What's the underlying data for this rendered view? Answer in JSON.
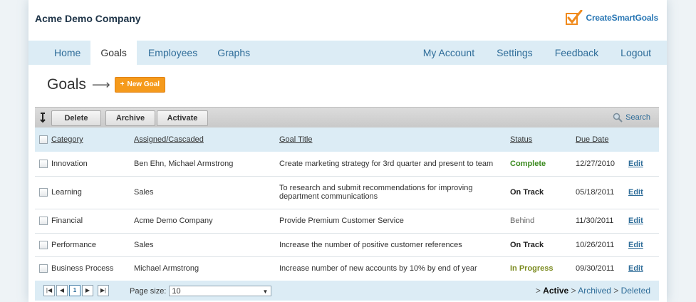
{
  "header": {
    "company": "Acme Demo Company",
    "logo_text": "CreateSmartGoals"
  },
  "nav": {
    "left": [
      "Home",
      "Goals",
      "Employees",
      "Graphs"
    ],
    "right": [
      "My Account",
      "Settings",
      "Feedback",
      "Logout"
    ],
    "active": "Goals"
  },
  "page": {
    "title": "Goals",
    "arrow": "⟶",
    "new_goal_label": "New Goal"
  },
  "toolbar": {
    "delete_label": "Delete",
    "archive_label": "Archive",
    "activate_label": "Activate",
    "search_label": "Search"
  },
  "table": {
    "headers": {
      "category": "Category",
      "assigned": "Assigned/Cascaded",
      "goal_title": "Goal Title",
      "status": "Status",
      "due_date": "Due Date"
    },
    "rows": [
      {
        "category": "Innovation",
        "assigned": "Ben Ehn, Michael Armstrong",
        "goal_title": "Create marketing strategy for 3rd quarter and present to team",
        "status": "Complete",
        "status_color": "#3a8a1e",
        "due_date": "12/27/2010",
        "edit": "Edit"
      },
      {
        "category": "Learning",
        "assigned": "Sales",
        "goal_title": "To research and submit recommendations for improving department communications",
        "status": "On Track",
        "status_color": "#222222",
        "due_date": "05/18/2011",
        "edit": "Edit"
      },
      {
        "category": "Financial",
        "assigned": "Acme Demo Company",
        "goal_title": "Provide Premium Customer Service",
        "status": "Behind",
        "status_color": "#666666",
        "due_date": "11/30/2011",
        "edit": "Edit"
      },
      {
        "category": "Performance",
        "assigned": "Sales",
        "goal_title": "Increase the number of positive customer references",
        "status": "On Track",
        "status_color": "#222222",
        "due_date": "10/26/2011",
        "edit": "Edit"
      },
      {
        "category": "Business Process",
        "assigned": "Michael Armstrong",
        "goal_title": "Increase number of new accounts by 10% by end of year",
        "status": "In Progress",
        "status_color": "#7a8a1e",
        "due_date": "09/30/2011",
        "edit": "Edit"
      }
    ]
  },
  "footer": {
    "pager": {
      "first": "|◀",
      "prev": "◀",
      "page": "1",
      "next": "▶",
      "last": "▶|"
    },
    "page_size_label": "Page size:",
    "page_size_value": "10",
    "filter_prefix": ">",
    "filters": [
      "Active",
      "Archived",
      "Deleted"
    ],
    "active_filter": "Active"
  },
  "colors": {
    "nav_bg": "#dcecf5",
    "link": "#2f6d99",
    "new_goal_button": "#f59a1c"
  }
}
